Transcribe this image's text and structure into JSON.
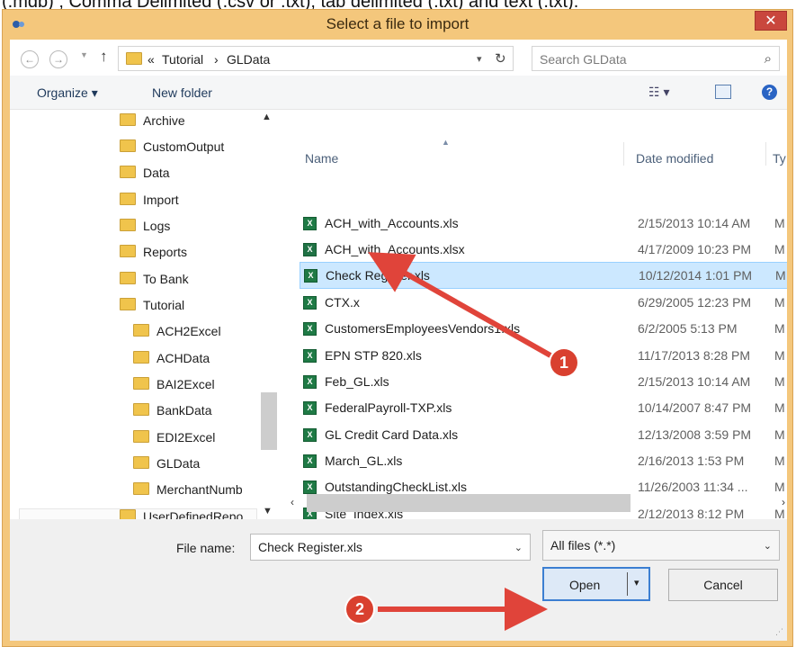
{
  "top_caption": "(.mdb) ; Comma Delimited (.csv or .txt), tab delimited (.txt) and text (.txt).",
  "window": {
    "title": "Select a file to import",
    "close": "✕"
  },
  "address_bar": {
    "back": "←",
    "forward": "→",
    "up": "↑",
    "crumbs": [
      "«",
      "Tutorial",
      "›",
      "GLData"
    ],
    "search_placeholder": "Search GLData"
  },
  "toolbar": {
    "organize": "Organize ▾",
    "new_folder": "New folder",
    "help": "?"
  },
  "nav_pane": {
    "items": [
      "Archive",
      "CustomOutput",
      "Data",
      "Import",
      "Logs",
      "Reports",
      "To Bank",
      "Tutorial",
      "ACH2Excel",
      "ACHData",
      "BAI2Excel",
      "BankData",
      "EDI2Excel",
      "GLData",
      "MerchantNumb",
      "UserDefinedRepo"
    ],
    "selected": "GLData"
  },
  "columns": {
    "name": "Name",
    "date": "Date modified",
    "type": "Ty"
  },
  "files": [
    {
      "name": "ACH_with_Accounts.xls",
      "date": "2/15/2013 10:14 AM",
      "type": "M",
      "kind": "xls"
    },
    {
      "name": "ACH_with_Accounts.xlsx",
      "date": "4/17/2009 10:23 PM",
      "type": "M",
      "kind": "xlsx"
    },
    {
      "name": "Check Register.xls",
      "date": "10/12/2014 1:01 PM",
      "type": "M",
      "kind": "xls",
      "selected": true
    },
    {
      "name": "CTX.x",
      "date": "6/29/2005 12:23 PM",
      "type": "M",
      "kind": "xls"
    },
    {
      "name": "CustomersEmployeesVendors1.xls",
      "date": "6/2/2005 5:13 PM",
      "type": "M",
      "kind": "xls"
    },
    {
      "name": "EPN STP 820.xls",
      "date": "11/17/2013 8:28 PM",
      "type": "M",
      "kind": "xls"
    },
    {
      "name": "Feb_GL.xls",
      "date": "2/15/2013 10:14 AM",
      "type": "M",
      "kind": "xls"
    },
    {
      "name": "FederalPayroll-TXP.xls",
      "date": "10/14/2007 8:47 PM",
      "type": "M",
      "kind": "xls"
    },
    {
      "name": "GL Credit Card Data.xls",
      "date": "12/13/2008 3:59 PM",
      "type": "M",
      "kind": "xls"
    },
    {
      "name": "March_GL.xls",
      "date": "2/16/2013 1:53 PM",
      "type": "M",
      "kind": "xls"
    },
    {
      "name": "OutstandingCheckList.xls",
      "date": "11/26/2003 11:34 ...",
      "type": "M",
      "kind": "xls"
    },
    {
      "name": "Site_Index.xls",
      "date": "2/12/2013 8:12 PM",
      "type": "M",
      "kind": "xls"
    }
  ],
  "file_name": {
    "label": "File name:",
    "value": "Check Register.xls"
  },
  "filter": {
    "value": "All files (*.*)"
  },
  "buttons": {
    "open": "Open",
    "cancel": "Cancel"
  },
  "callouts": [
    "1",
    "2"
  ],
  "colors": {
    "title_bar": "#f4c77c",
    "selection": "#cce8ff",
    "callout": "#d9402f",
    "arrow": "#e0443a"
  }
}
